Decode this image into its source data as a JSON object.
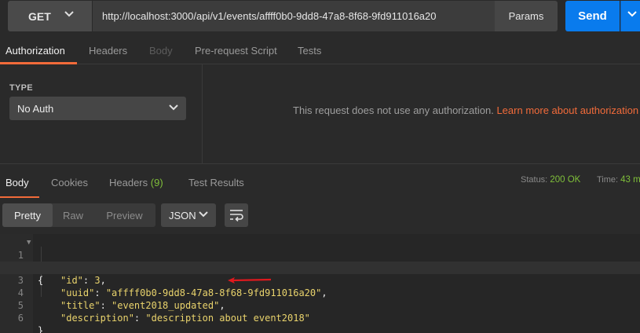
{
  "request": {
    "method": "GET",
    "url": "http://localhost:3000/api/v1/events/affff0b0-9dd8-47a8-8f68-9fd911016a20",
    "params_label": "Params",
    "send_label": "Send"
  },
  "request_tabs": [
    {
      "label": "Authorization",
      "state": "active"
    },
    {
      "label": "Headers",
      "state": "normal"
    },
    {
      "label": "Body",
      "state": "disabled"
    },
    {
      "label": "Pre-request Script",
      "state": "normal"
    },
    {
      "label": "Tests",
      "state": "normal"
    }
  ],
  "auth": {
    "type_label": "TYPE",
    "type_value": "No Auth",
    "message": "This request does not use any authorization.",
    "learn_more": "Learn more about authorization"
  },
  "response_tabs": {
    "body": "Body",
    "cookies": "Cookies",
    "headers": "Headers",
    "headers_count": "(9)",
    "test_results": "Test Results"
  },
  "status": {
    "status_label": "Status:",
    "status_value": "200 OK",
    "time_label": "Time:",
    "time_value": "43 m"
  },
  "view_modes": [
    "Pretty",
    "Raw",
    "Preview"
  ],
  "format": "JSON",
  "code_lines": [
    {
      "num": "1",
      "text": "{"
    },
    {
      "num": "2",
      "key": "\"id\"",
      "value": "3",
      "trail": ","
    },
    {
      "num": "3",
      "key": "\"uuid\"",
      "value": "\"affff0b0-9dd8-47a8-8f68-9fd911016a20\"",
      "trail": ","
    },
    {
      "num": "4",
      "key": "\"title\"",
      "value": "\"event2018_updated\"",
      "trail": ","
    },
    {
      "num": "5",
      "key": "\"description\"",
      "value": "\"description about event2018\"",
      "trail": ""
    },
    {
      "num": "6",
      "text": "}"
    }
  ],
  "colors": {
    "accent": "#f26b3a",
    "send": "#097bed",
    "success": "#7fbf3a",
    "annotation_arrow": "#e0191e"
  }
}
